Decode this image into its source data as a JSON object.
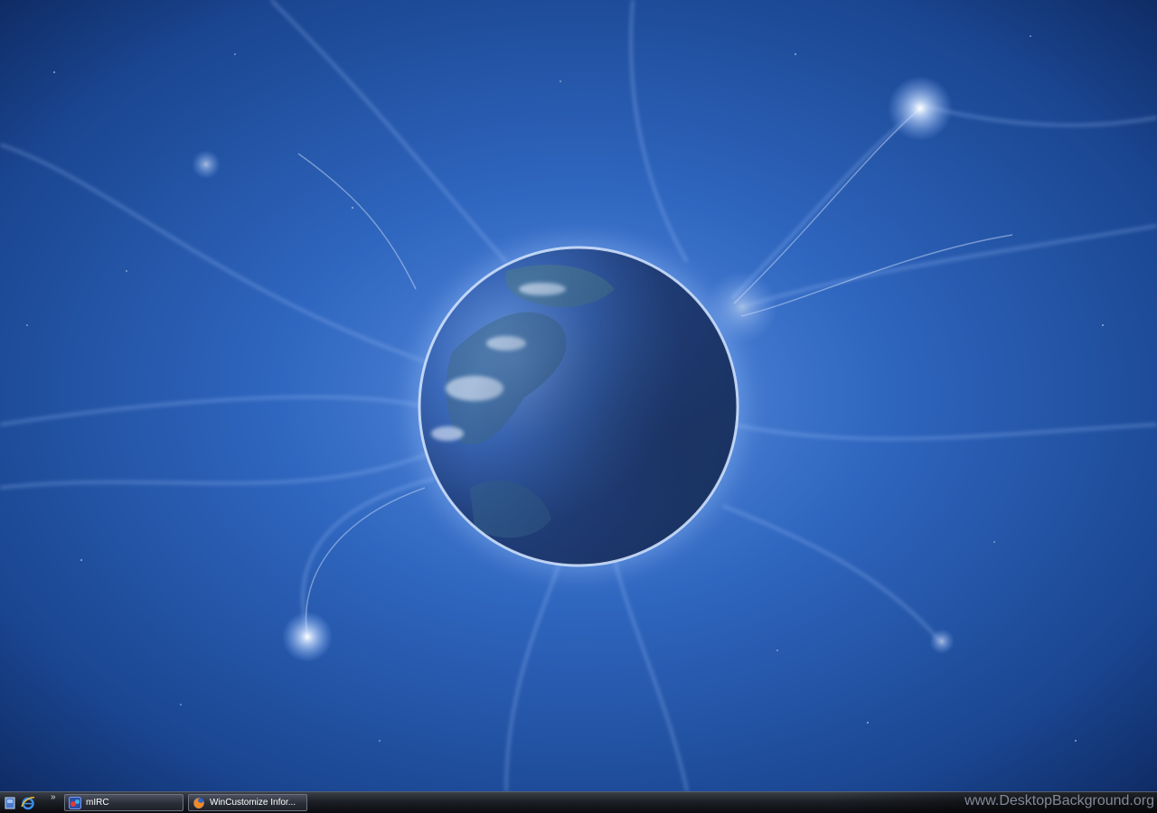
{
  "taskbar": {
    "quicklaunch": [
      {
        "icon": "show-desktop-icon"
      },
      {
        "icon": "internet-explorer-icon"
      }
    ],
    "more_label": "»",
    "tasks": [
      {
        "label": "mIRC",
        "icon": "mirc-icon"
      },
      {
        "label": "WinCustomize Infor...",
        "icon": "firefox-icon"
      }
    ]
  },
  "watermark": "www.DesktopBackground.org",
  "colors": {
    "space_deep": "#0d2a5e",
    "space_mid": "#2d63b8",
    "glow": "#bcd8ff",
    "taskbar": "#1c1f25"
  }
}
